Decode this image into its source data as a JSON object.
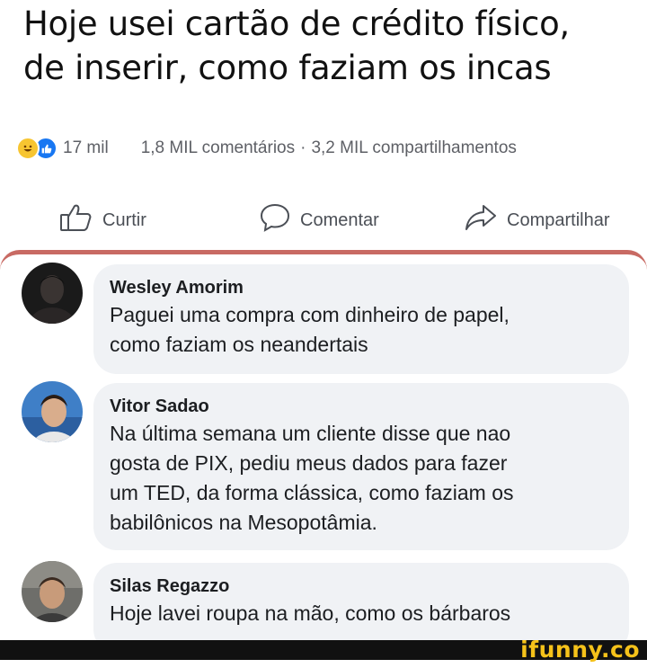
{
  "post": {
    "text_line1": "Hoje usei cartão de crédito físico,",
    "text_line2": "de inserir, como faziam os incas"
  },
  "stats": {
    "reactions_count": "17 mil",
    "comments": "1,8 MIL comentários",
    "separator": "·",
    "shares": "3,2 MIL compartilhamentos",
    "reaction_icons": [
      "haha-icon",
      "like-icon"
    ]
  },
  "actions": {
    "like": "Curtir",
    "comment": "Comentar",
    "share": "Compartilhar"
  },
  "comments": [
    {
      "author": "Wesley Amorim",
      "lines": [
        "Paguei uma compra com dinheiro de papel,",
        "como faziam os neandertais"
      ]
    },
    {
      "author": "Vitor Sadao",
      "lines": [
        "Na última semana um cliente disse que nao",
        "gosta de PIX, pediu meus dados para fazer",
        "um TED, da forma clássica, como faziam os",
        "babilônicos na Mesopotâmia."
      ]
    },
    {
      "author": "Silas Regazzo",
      "lines": [
        "Hoje lavei roupa na mão, como os bárbaros"
      ]
    }
  ],
  "watermark": "ifunny.co",
  "colors": {
    "highlight_border": "#c86a63",
    "bubble": "#f0f2f5",
    "like_blue": "#1877f2",
    "watermark": "#f5c21a"
  }
}
